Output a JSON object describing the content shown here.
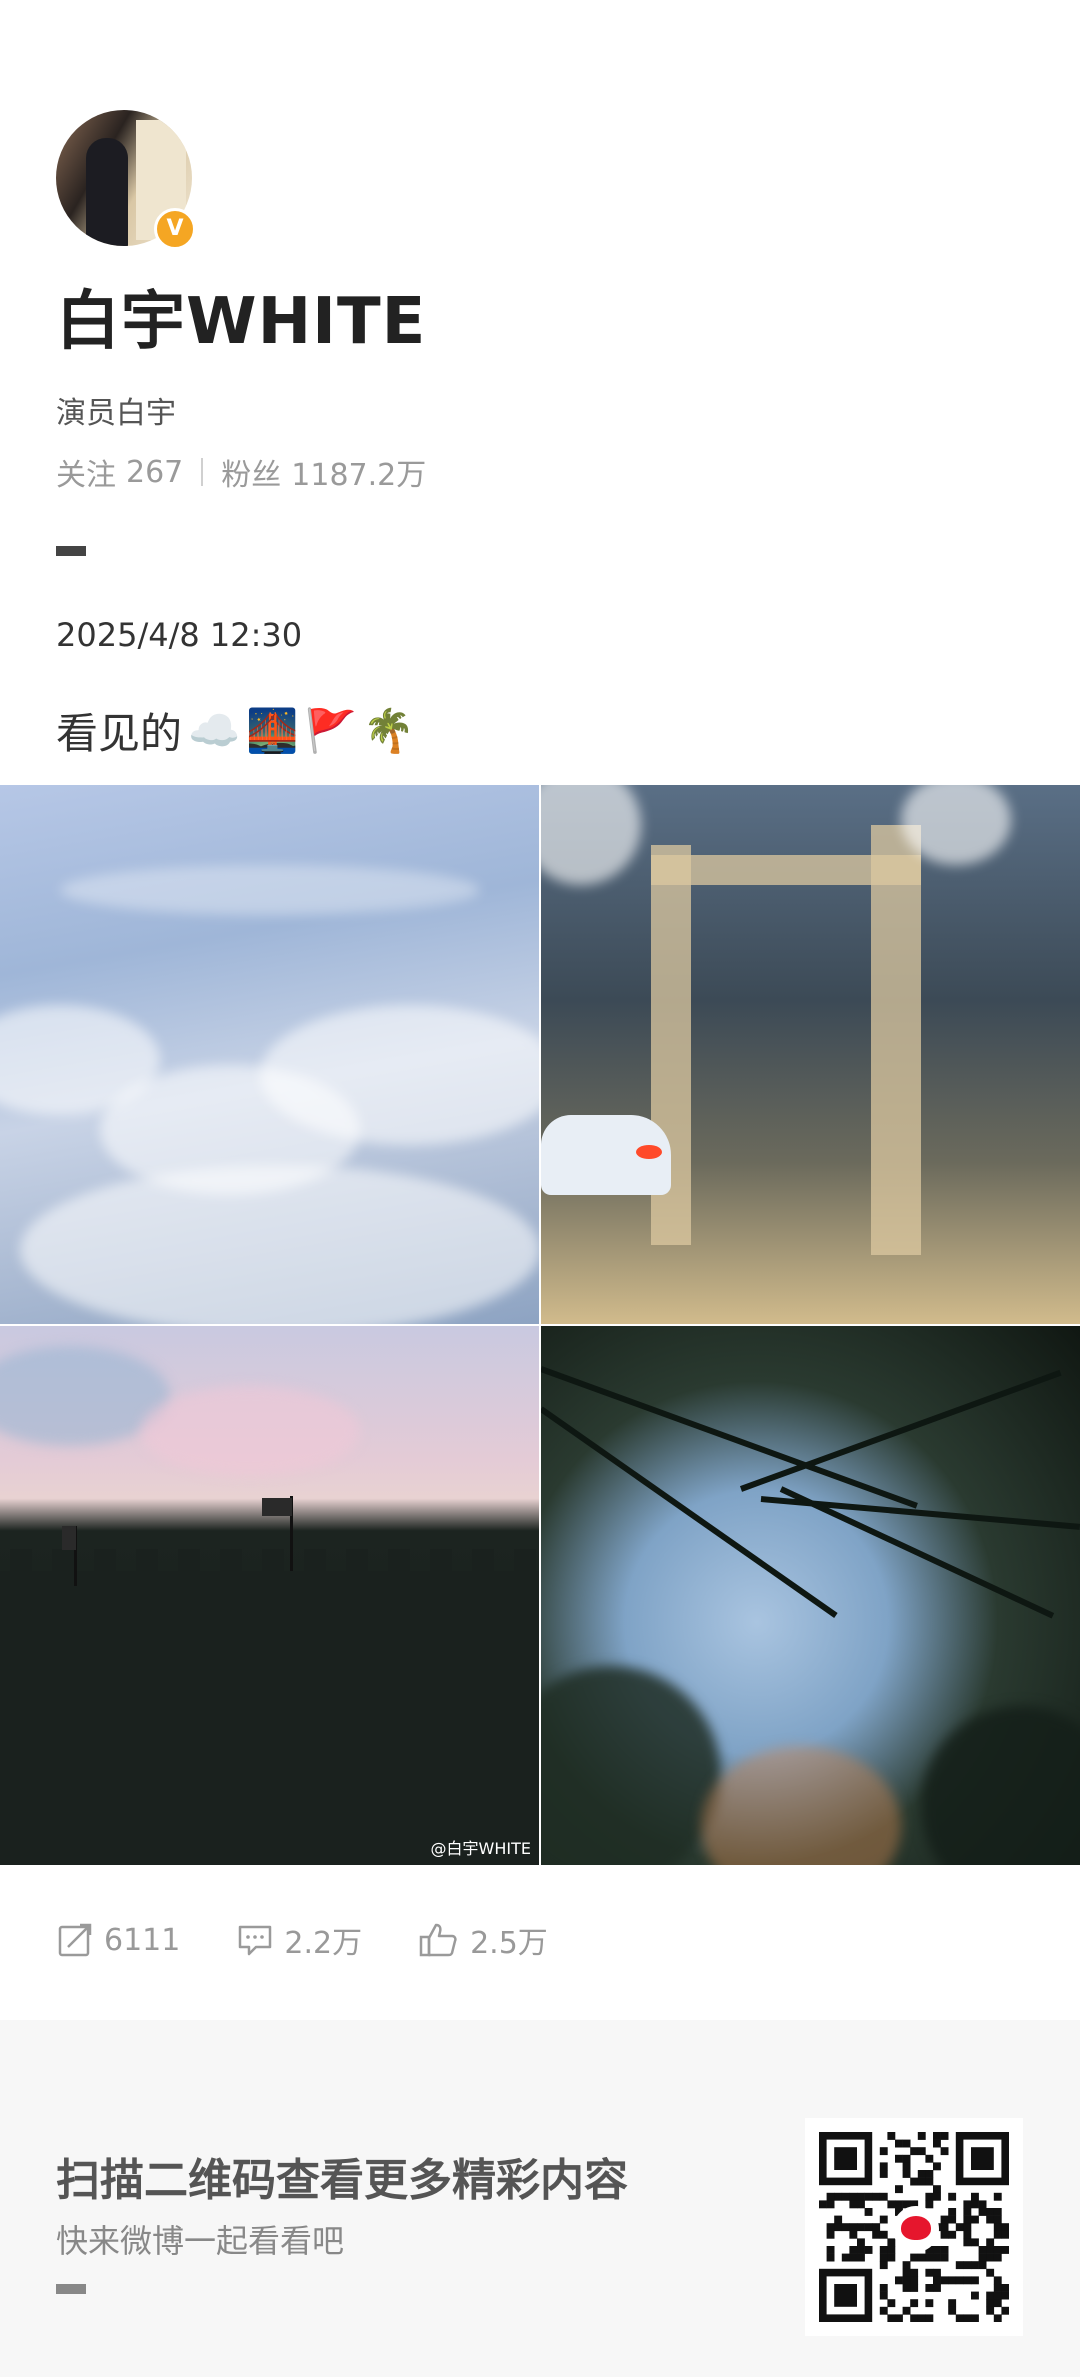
{
  "profile": {
    "username": "白宇WHITE",
    "verified_badge": "V",
    "bio": "演员白宇",
    "following_label": "关注",
    "following_count": "267",
    "followers_label": "粉丝",
    "followers_count": "1187.2万"
  },
  "post": {
    "time": "2025/4/8 12:30",
    "text": "看见的",
    "emojis": [
      "☁️",
      "🌉",
      "🚩",
      "🌴"
    ],
    "image_watermark": "@白宇WHITE",
    "stats": {
      "reposts": "6111",
      "comments": "2.2万",
      "likes": "2.5万"
    }
  },
  "footer": {
    "title": "扫描二维码查看更多精彩内容",
    "subtitle": "快来微博一起看看吧"
  },
  "colors": {
    "badge": "#f5a623",
    "weibo_red": "#e6162d",
    "footer_bg": "#f7f7f7"
  },
  "icons": [
    "repost-icon",
    "comment-icon",
    "like-icon",
    "verified-icon",
    "weibo-logo-icon",
    "qr-code"
  ]
}
